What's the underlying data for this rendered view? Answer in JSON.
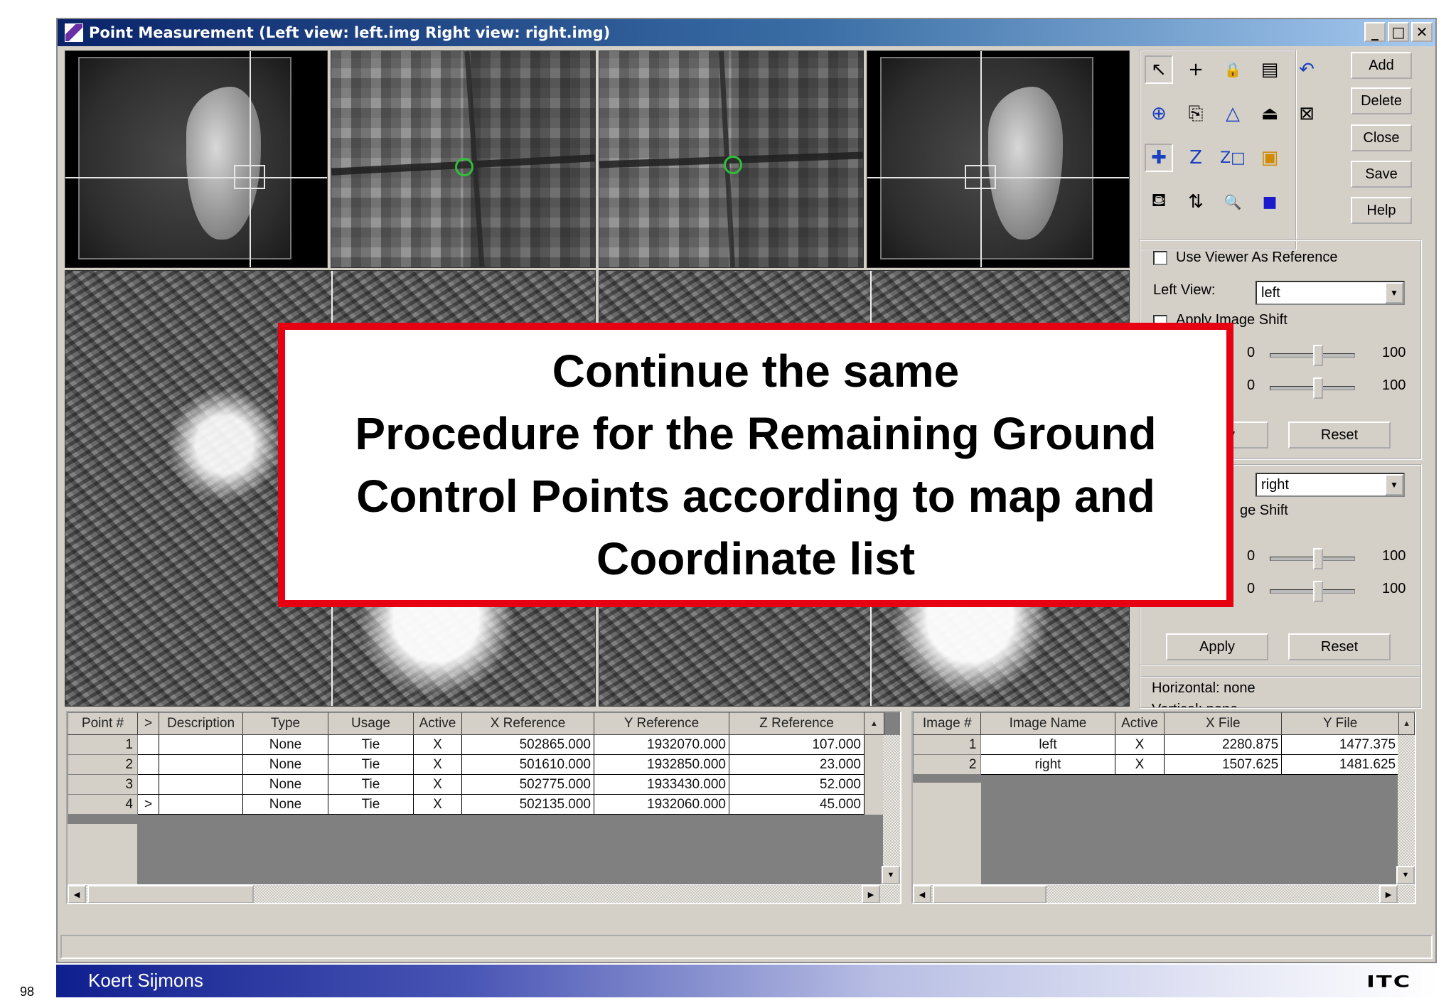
{
  "window": {
    "title": "Point Measurement (Left view: left.img  Right view: right.img)",
    "minimize": "_",
    "maximize": "□",
    "close": "✕"
  },
  "right_buttons": [
    "Add",
    "Delete",
    "Close",
    "Save",
    "Help"
  ],
  "tools": [
    {
      "name": "select-arrow-icon",
      "glyph": "↖"
    },
    {
      "name": "crosshair-icon",
      "glyph": "+"
    },
    {
      "name": "lock-icon",
      "glyph": "🔒"
    },
    {
      "name": "grid-table-icon",
      "glyph": "▤"
    },
    {
      "name": "undo-icon",
      "glyph": "↶"
    },
    {
      "name": "add-point-icon",
      "glyph": "⊕"
    },
    {
      "name": "create-point-icon",
      "glyph": "⎘"
    },
    {
      "name": "triangle-icon",
      "glyph": "△"
    },
    {
      "name": "drive-triangle-icon",
      "glyph": "⏏"
    },
    {
      "name": "update-icon",
      "glyph": "⊠"
    },
    {
      "name": "add-gcp-icon",
      "glyph": "✚"
    },
    {
      "name": "z-icon",
      "glyph": "Z"
    },
    {
      "name": "z-box-icon",
      "glyph": "Z□"
    },
    {
      "name": "color-box-icon",
      "glyph": "▣"
    },
    {
      "name": "blank-icon",
      "glyph": ""
    },
    {
      "name": "stamp-icon",
      "glyph": "⛾"
    },
    {
      "name": "swap-arrows-icon",
      "glyph": "⇅"
    },
    {
      "name": "zoom-box-icon",
      "glyph": "🔍"
    },
    {
      "name": "blue-square-icon",
      "glyph": "■"
    }
  ],
  "reference_panel": {
    "use_viewer_label": "Use Viewer As Reference",
    "left_view_label": "Left View:",
    "left_view_value": "left",
    "apply_image_shift_label": "Apply Image Shift",
    "slider_min": "0",
    "slider_max_1": "100",
    "slider_max_2": "100",
    "apply_label": "Apply",
    "reset_label": "Reset",
    "right_view_value": "right",
    "image_shift_partial": "ge Shift",
    "slider_max_3": "100",
    "slider_max_4": "100"
  },
  "info_panel": {
    "horizontal": "Horizontal: none",
    "vertical": "Vertical: none"
  },
  "point_table": {
    "columns": [
      "Point #",
      ">",
      "Description",
      "Type",
      "Usage",
      "Active",
      "X Reference",
      "Y Reference",
      "Z Reference"
    ],
    "rows": [
      {
        "id": "1",
        "marker": "",
        "description": "",
        "type": "None",
        "usage": "Tie",
        "active": "X",
        "x": "502865.000",
        "y": "1932070.000",
        "z": "107.000"
      },
      {
        "id": "2",
        "marker": "",
        "description": "",
        "type": "None",
        "usage": "Tie",
        "active": "X",
        "x": "501610.000",
        "y": "1932850.000",
        "z": "23.000"
      },
      {
        "id": "3",
        "marker": "",
        "description": "",
        "type": "None",
        "usage": "Tie",
        "active": "X",
        "x": "502775.000",
        "y": "1933430.000",
        "z": "52.000"
      },
      {
        "id": "4",
        "marker": ">",
        "description": "",
        "type": "None",
        "usage": "Tie",
        "active": "X",
        "x": "502135.000",
        "y": "1932060.000",
        "z": "45.000"
      }
    ]
  },
  "image_table": {
    "columns": [
      "Image #",
      "Image Name",
      "Active",
      "X File",
      "Y File"
    ],
    "rows": [
      {
        "id": "1",
        "name": "left",
        "active": "X",
        "x": "2280.875",
        "y": "1477.375"
      },
      {
        "id": "2",
        "name": "right",
        "active": "X",
        "x": "1507.625",
        "y": "1481.625"
      }
    ]
  },
  "callout": {
    "lines": [
      "Continue the same",
      "Procedure for the Remaining Ground",
      "Control Points according to map and",
      "Coordinate list"
    ]
  },
  "footer": {
    "author": "Koert Sijmons",
    "page": "98",
    "logo": "ITC"
  },
  "colors": {
    "callout_border": "#e60012",
    "gcp_marker": "#2fbf3a",
    "title_bar": "#0a246a"
  }
}
